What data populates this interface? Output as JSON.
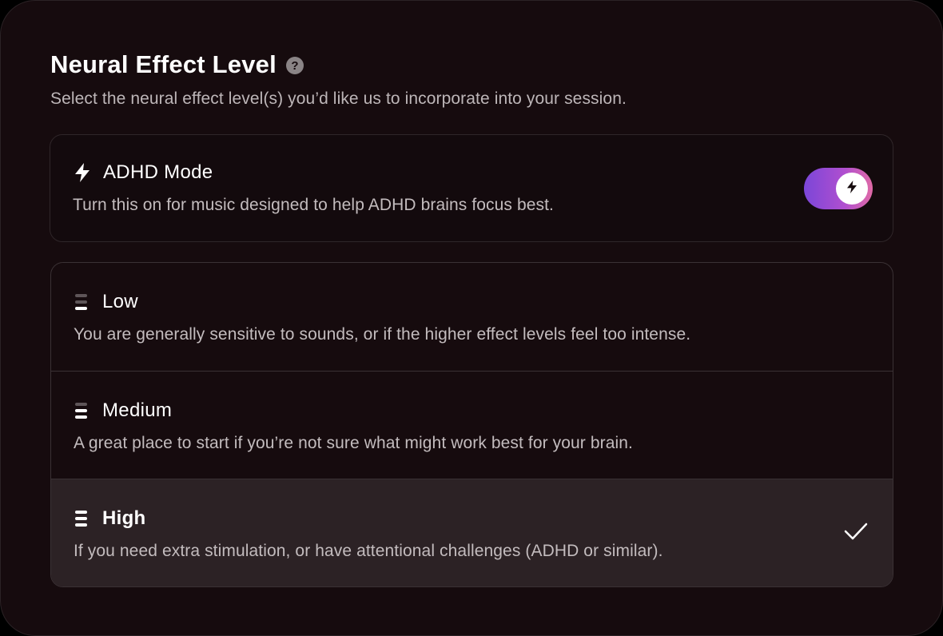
{
  "header": {
    "title": "Neural Effect Level",
    "help_icon": "question-circle-icon",
    "help_glyph": "?",
    "subtitle": "Select the neural effect level(s) you’d like us to incorporate into your session."
  },
  "adhd_mode": {
    "icon": "lightning-bolt-icon",
    "title": "ADHD Mode",
    "description": "Turn this on for music designed to help ADHD brains focus best.",
    "toggle_on": true,
    "toggle_colors": [
      "#7b46d8",
      "#b14fcf",
      "#e06aa6"
    ]
  },
  "levels": [
    {
      "icon": "bars-low-icon",
      "label": "Low",
      "description": "You are generally sensitive to sounds, or if the higher effect levels feel too intense.",
      "selected": false
    },
    {
      "icon": "bars-medium-icon",
      "label": "Medium",
      "description": "A great place to start if you’re not sure what might work best for your brain.",
      "selected": false
    },
    {
      "icon": "bars-high-icon",
      "label": "High",
      "description": "If you need extra stimulation, or have attentional challenges (ADHD or similar).",
      "selected": true
    }
  ],
  "colors": {
    "background": "#160b0e",
    "selected_row": "#2c2225",
    "text_primary": "#ffffff",
    "text_secondary": "#c3bcbe"
  }
}
